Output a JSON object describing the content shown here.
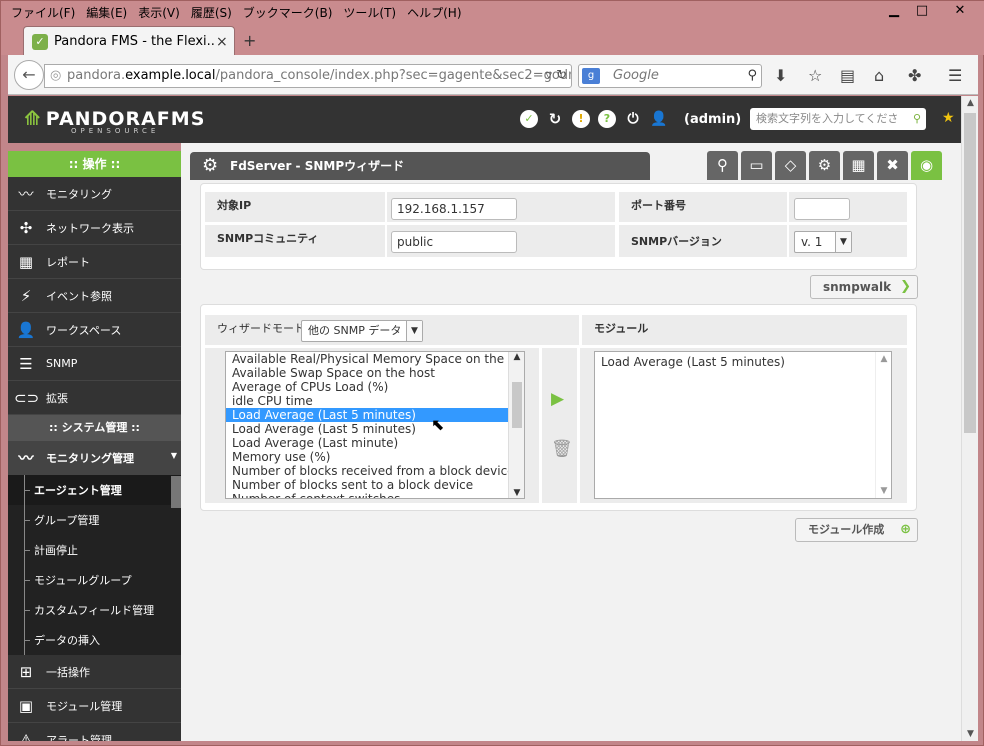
{
  "menu": [
    "ファイル(F)",
    "編集(E)",
    "表示(V)",
    "履歴(S)",
    "ブックマーク(B)",
    "ツール(T)",
    "ヘルプ(H)"
  ],
  "tab": {
    "title": "Pandora FMS - the Flexi...",
    "close": "×",
    "new": "+"
  },
  "nav": {
    "url_prefix": "pandora.",
    "url_host": "example.local",
    "url_path": "/pandora_console/index.php?sec=gagente&sec2=godm",
    "search_placeholder": "Google",
    "search_engine": "g"
  },
  "header": {
    "logo": "PANDORAFMS",
    "logo_sub": "OPENSOURCE",
    "user": "(admin)",
    "search_placeholder": "検索文字列を入力してくださ"
  },
  "sidebar": {
    "section1": ":: 操作 ::",
    "ops": [
      {
        "label": "モニタリング",
        "icon": "monitoring-icon"
      },
      {
        "label": "ネットワーク表示",
        "icon": "network-icon"
      },
      {
        "label": "レポート",
        "icon": "report-icon"
      },
      {
        "label": "イベント参照",
        "icon": "event-icon"
      },
      {
        "label": "ワークスペース",
        "icon": "workspace-icon"
      },
      {
        "label": "SNMP",
        "icon": "snmp-icon"
      },
      {
        "label": "拡張",
        "icon": "extension-icon"
      }
    ],
    "section2": ":: システム管理 ::",
    "active": "モニタリング管理",
    "subs": [
      "エージェント管理",
      "グループ管理",
      "計画停止",
      "モジュールグループ",
      "カスタムフィールド管理",
      "データの挿入"
    ],
    "more": [
      {
        "label": "一括操作",
        "icon": "bulk-icon"
      },
      {
        "label": "モジュール管理",
        "icon": "module-admin-icon"
      },
      {
        "label": "アラート管理",
        "icon": "alert-icon"
      }
    ]
  },
  "page": {
    "title": "FdServer - SNMPウィザード"
  },
  "form": {
    "ip_label": "対象IP",
    "ip_value": "192.168.1.157",
    "port_label": "ポート番号",
    "port_value": "",
    "community_label": "SNMPコミュニティ",
    "community_value": "public",
    "version_label": "SNMPバージョン",
    "version_value": "v. 1",
    "snmpwalk": "snmpwalk"
  },
  "wizard": {
    "mode_label": "ウィザードモード:",
    "mode_value": "他の SNMP データ",
    "modules_label": "モジュール",
    "options": [
      "Available Real/Physical Memory Space on the host",
      "Available Swap Space on the host",
      "Average of CPUs Load (%)",
      "idle CPU time",
      "Load Average (Last 5 minutes)",
      "Load Average (Last 5 minutes)",
      "Load Average (Last minute)",
      "Memory use (%)",
      "Number of blocks received from a block device",
      "Number of blocks sent to a block device",
      "Number of context switches"
    ],
    "selected_index": 4,
    "modules": [
      "Load Average (Last 5 minutes)"
    ],
    "create": "モジュール作成"
  },
  "colors": {
    "accent": "#7ac142",
    "header": "#333333",
    "selected": "#3399ff"
  }
}
